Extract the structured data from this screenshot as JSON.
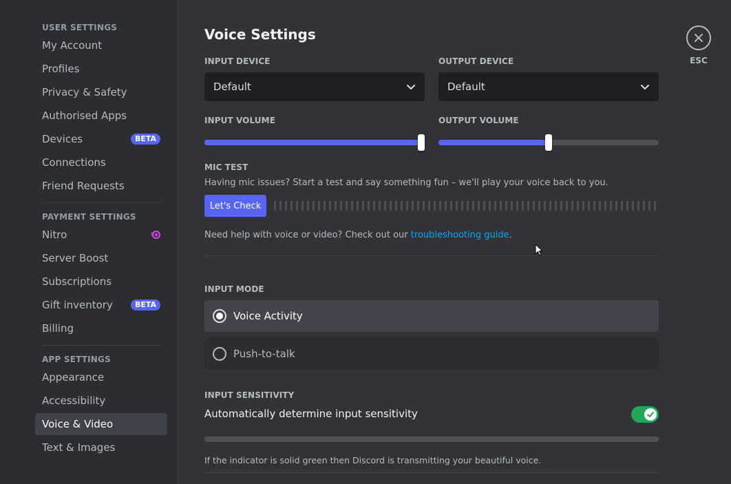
{
  "sidebar": {
    "sections": [
      {
        "header": "User Settings",
        "items": [
          {
            "label": "My Account"
          },
          {
            "label": "Profiles"
          },
          {
            "label": "Privacy & Safety"
          },
          {
            "label": "Authorised Apps"
          },
          {
            "label": "Devices",
            "badge": "BETA"
          },
          {
            "label": "Connections"
          },
          {
            "label": "Friend Requests"
          }
        ]
      },
      {
        "header": "Payment Settings",
        "items": [
          {
            "label": "Nitro",
            "icon": "nitro-icon"
          },
          {
            "label": "Server Boost"
          },
          {
            "label": "Subscriptions"
          },
          {
            "label": "Gift inventory",
            "badge": "BETA"
          },
          {
            "label": "Billing"
          }
        ]
      },
      {
        "header": "App Settings",
        "items": [
          {
            "label": "Appearance"
          },
          {
            "label": "Accessibility"
          },
          {
            "label": "Voice & Video",
            "active": true
          },
          {
            "label": "Text & Images"
          }
        ]
      }
    ]
  },
  "main": {
    "title": "Voice Settings",
    "input_device": {
      "label": "Input Device",
      "value": "Default"
    },
    "output_device": {
      "label": "Output Device",
      "value": "Default"
    },
    "input_volume": {
      "label": "Input Volume",
      "percent": 100
    },
    "output_volume": {
      "label": "Output Volume",
      "percent": 50
    },
    "mic_test": {
      "label": "Mic Test",
      "description": "Having mic issues? Start a test and say something fun – we'll play your voice back to you.",
      "button": "Let's Check"
    },
    "help": {
      "prefix": "Need help with voice or video? Check out our ",
      "link": "troubleshooting guide",
      "suffix": "."
    },
    "input_mode": {
      "label": "Input Mode",
      "options": [
        {
          "label": "Voice Activity",
          "selected": true
        },
        {
          "label": "Push-to-talk",
          "selected": false
        }
      ]
    },
    "input_sensitivity": {
      "label": "Input Sensitivity",
      "auto_label": "Automatically determine input sensitivity",
      "auto_enabled": true,
      "note": "If the indicator is solid green then Discord is transmitting your beautiful voice."
    }
  },
  "close": {
    "label": "ESC"
  },
  "colors": {
    "accent": "#5865f2",
    "success": "#23a55a",
    "link": "#00a8fc"
  }
}
